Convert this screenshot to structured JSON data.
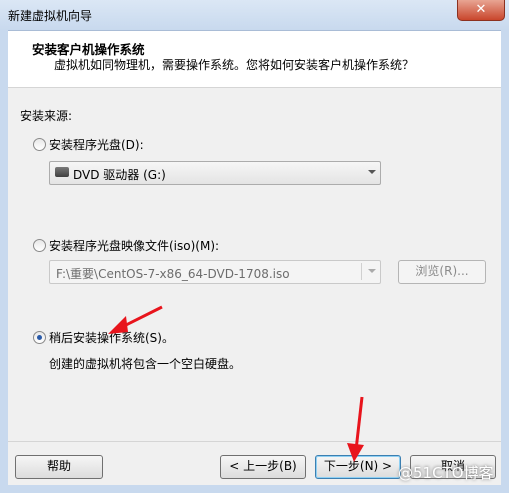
{
  "window": {
    "title": "新建虚拟机向导",
    "close_label": "✕"
  },
  "header": {
    "title": "安装客户机操作系统",
    "subtitle": "虚拟机如同物理机，需要操作系统。您将如何安装客户机操作系统？"
  },
  "source": {
    "label": "安装来源:",
    "options": [
      {
        "label": "安装程序光盘(D):",
        "selected": false
      },
      {
        "label": "安装程序光盘映像文件(iso)(M):",
        "selected": false
      },
      {
        "label": "稍后安装操作系统(S)。",
        "selected": true
      }
    ],
    "dvd_combo_value": "DVD 驱动器 (G:)",
    "iso_combo_value": "F:\\重要\\CentOS-7-x86_64-DVD-1708.iso",
    "browse_label": "浏览(R)...",
    "later_desc": "创建的虚拟机将包含一个空白硬盘。"
  },
  "footer": {
    "help_label": "帮助",
    "back_label": "< 上一步(B)",
    "next_label": "下一步(N) >",
    "cancel_label": "取消"
  },
  "watermark": "@51CTO博客",
  "colors": {
    "annotation_arrow": "#e8141c"
  }
}
